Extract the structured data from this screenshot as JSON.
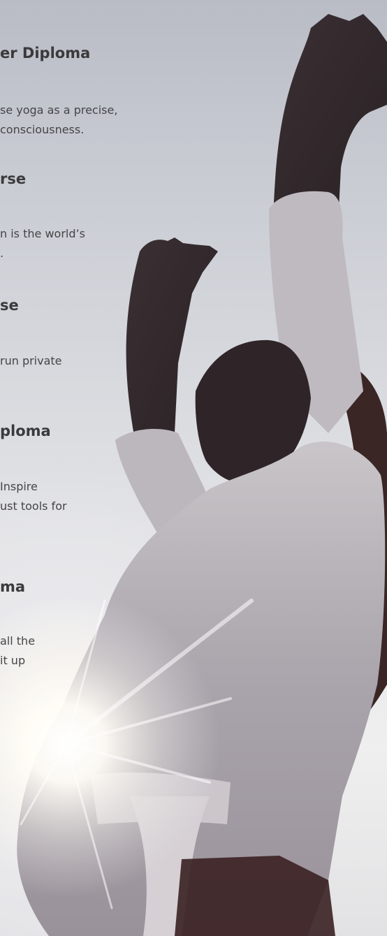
{
  "sections": [
    {
      "heading": "er Diploma",
      "lines": [
        "se yoga as a precise,",
        "consciousness."
      ]
    },
    {
      "heading": "rse",
      "lines": [
        "n is the world’s",
        "."
      ]
    },
    {
      "heading": "se",
      "lines": [
        "run private"
      ]
    },
    {
      "heading": "ploma",
      "lines": [
        " Inspire",
        "ust tools for"
      ]
    },
    {
      "heading": "ma",
      "lines": [
        " all the",
        " it up"
      ]
    }
  ]
}
